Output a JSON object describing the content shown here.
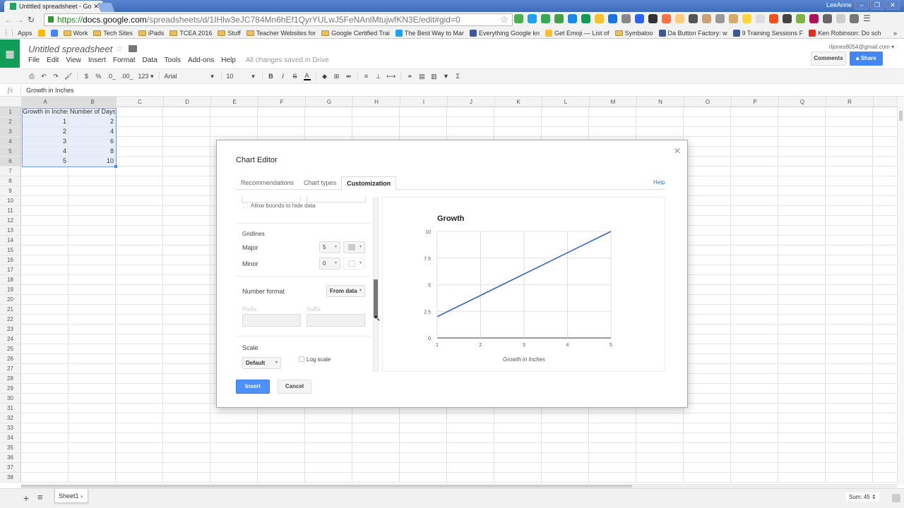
{
  "browser": {
    "tab_title": "Untitled spreadsheet - Go",
    "url_scheme": "https://",
    "url_host": "docs.google.com",
    "url_path": "/spreadsheets/d/1IHlw3eJC784Mn6hEf1QyrYULwJ5FeNAnlMtujwfKN3E/edit#gid=0",
    "user": "LeeAnne",
    "window_buttons": [
      "–",
      "❐",
      "✕"
    ],
    "extension_colors": [
      "#4caf50",
      "#1da1f2",
      "#34a853",
      "#43a047",
      "#1e88e5",
      "#0f9d58",
      "#fbc02d",
      "#1a73e8",
      "#888",
      "#2962ff",
      "#333",
      "#ff7043",
      "#ffcc80",
      "#555",
      "#c8a27a",
      "#999",
      "#d4a96a",
      "#fdd835",
      "#ddd",
      "#f4511e",
      "#444",
      "#7cb342",
      "#ad1457",
      "#666",
      "#ccc",
      "#777"
    ],
    "bookmarks": [
      {
        "label": "Apps",
        "icon": "apps-grid-icon"
      },
      {
        "label": "",
        "icon": "google-drive-icon"
      },
      {
        "label": "",
        "icon": "calendar-icon"
      },
      {
        "label": "Work",
        "icon": "folder-icon"
      },
      {
        "label": "Tech Sites",
        "icon": "folder-icon"
      },
      {
        "label": "iPads",
        "icon": "folder-icon"
      },
      {
        "label": "TCEA 2016",
        "icon": "folder-icon"
      },
      {
        "label": "Stuff",
        "icon": "folder-icon"
      },
      {
        "label": "Teacher Websites for",
        "icon": "folder-icon"
      },
      {
        "label": "Google Certified Trai",
        "icon": "folder-icon"
      },
      {
        "label": "The Best Way to Mar",
        "icon": "bird-icon"
      },
      {
        "label": "Everything Google kn",
        "icon": "site-icon"
      },
      {
        "label": "Get Emoji — List of",
        "icon": "emoji-icon"
      },
      {
        "label": "Symbaloo",
        "icon": "folder-icon"
      },
      {
        "label": "Da Button Factory: w",
        "icon": "site-icon"
      },
      {
        "label": "9 Training Sessions F",
        "icon": "site-icon"
      },
      {
        "label": "Ken Robinson: Do sch",
        "icon": "ted-icon"
      }
    ],
    "bookmarks_overflow": "»"
  },
  "app": {
    "doc_title": "Untitled spreadsheet",
    "menu": [
      "File",
      "Edit",
      "View",
      "Insert",
      "Format",
      "Data",
      "Tools",
      "Add-ons",
      "Help"
    ],
    "save_status": "All changes saved in Drive",
    "account": "rljones8054@gmail.com ▾",
    "comments_label": "Comments",
    "share_label": "Share",
    "toolbar": {
      "currency": "$",
      "percent": "%",
      "dec_decrease": ".0_",
      "dec_increase": ".00_",
      "more_formats": "123 ▾",
      "font": "Arial",
      "font_size": "10",
      "bold": "B",
      "italic": "I",
      "strike": "S",
      "text_color": "A"
    },
    "formula_label": "fx",
    "formula_value": "Growth in Inches"
  },
  "sheet": {
    "columns": [
      "A",
      "B",
      "C",
      "D",
      "E",
      "F",
      "G",
      "H",
      "I",
      "J",
      "K",
      "L",
      "M",
      "N",
      "O",
      "P",
      "Q",
      "R"
    ],
    "selected_columns": [
      "A",
      "B"
    ],
    "cells": [
      [
        "Growth in Inches",
        "Number of Days"
      ],
      [
        "1",
        "2"
      ],
      [
        "2",
        "4"
      ],
      [
        "3",
        "6"
      ],
      [
        "4",
        "8"
      ],
      [
        "5",
        "10"
      ]
    ],
    "row_count": 38,
    "sheet_tab": "Sheet1",
    "sum_label": "Sum: 45"
  },
  "chart_editor": {
    "title": "Chart Editor",
    "tabs": [
      "Recommendations",
      "Chart types",
      "Customization"
    ],
    "active_tab": "Customization",
    "help_label": "Help",
    "allow_bounds_label": "Allow bounds to hide data",
    "gridlines_label": "Gridlines",
    "major_label": "Major",
    "major_value": "5",
    "minor_label": "Minor",
    "minor_value": "0",
    "number_format_label": "Number format",
    "number_format_value": "From data",
    "prefix_label": "Prefix",
    "suffix_label": "Suffix",
    "scale_label": "Scale",
    "scale_value": "Default",
    "log_scale_label": "Log scale",
    "insert_label": "Insert",
    "cancel_label": "Cancel"
  },
  "chart_data": {
    "type": "line",
    "title": "Growth",
    "xlabel": "Growth in Inches",
    "ylabel": "",
    "x": [
      1,
      2,
      3,
      4,
      5
    ],
    "series": [
      {
        "name": "Number of Days",
        "values": [
          2,
          4,
          6,
          8,
          10
        ],
        "color": "#3366cc"
      }
    ],
    "xticks": [
      "1",
      "2",
      "3",
      "4",
      "5"
    ],
    "yticks": [
      "0",
      "2.5",
      "5",
      "7.5",
      "10"
    ],
    "xlim": [
      1,
      5
    ],
    "ylim": [
      0,
      10
    ],
    "grid": true,
    "legend": "none"
  }
}
